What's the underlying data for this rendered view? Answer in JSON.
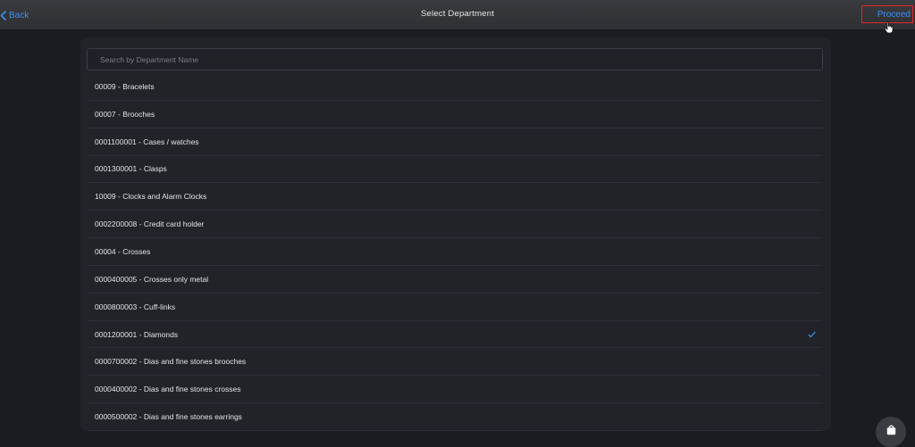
{
  "header": {
    "back_label": "Back",
    "title": "Select Department",
    "proceed_label": "Proceed"
  },
  "search": {
    "placeholder": "Search by Department Name",
    "value": ""
  },
  "departments": [
    {
      "label": "00009 - Bracelets",
      "selected": false
    },
    {
      "label": "00007 - Brooches",
      "selected": false
    },
    {
      "label": "0001100001 - Cases / watches",
      "selected": false
    },
    {
      "label": "0001300001 - Clasps",
      "selected": false
    },
    {
      "label": "10009 - Clocks and Alarm Clocks",
      "selected": false
    },
    {
      "label": "0002200008 - Credit card holder",
      "selected": false
    },
    {
      "label": "00004 - Crosses",
      "selected": false
    },
    {
      "label": "0000400005 - Crosses only metal",
      "selected": false
    },
    {
      "label": "0000800003 - Cuff-links",
      "selected": false
    },
    {
      "label": "0001200001 - Diamonds",
      "selected": true
    },
    {
      "label": "0000700002 - Dias and fine stones brooches",
      "selected": false
    },
    {
      "label": "0000400002 - Dias and fine stones crosses",
      "selected": false
    },
    {
      "label": "0000500002 - Dias and fine stones earrings",
      "selected": false
    }
  ],
  "colors": {
    "accent": "#3d8ff0",
    "highlight_box": "#e02828",
    "background": "#1b1c21",
    "panel": "#212329"
  },
  "icons": {
    "back": "chevron-left-icon",
    "selected": "checkmark-icon",
    "fab": "shopping-bag-icon",
    "pointer": "hand-pointer-icon"
  }
}
